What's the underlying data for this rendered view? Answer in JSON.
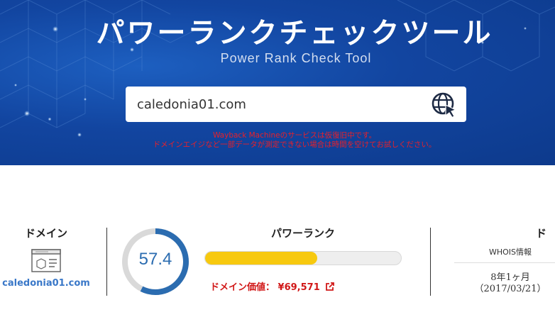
{
  "header": {
    "title": "パワーランクチェックツール",
    "subtitle": "Power Rank Check Tool"
  },
  "search": {
    "value": "caledonia01.com",
    "button_icon": "globe-cursor-icon"
  },
  "notice": {
    "line1": "Wayback Machineのサービスは仮復旧中です。",
    "line2": "ドメインエイジなど一部データが測定できない場合は時間を空けてお試しください。",
    "color": "#e8202a"
  },
  "result": {
    "domain": {
      "label": "ドメイン",
      "icon": "webpage-icon",
      "value": "caledonia01.com"
    },
    "power_rank": {
      "label": "パワーランク",
      "score": "57.4",
      "score_fraction": 0.574,
      "domain_value_label": "ドメイン価値：",
      "domain_value": "¥69,571",
      "link_icon": "external-link-icon"
    },
    "whois": {
      "label": "ド",
      "source": "WHOIS情報",
      "age": "8年1ヶ月",
      "date": "（2017/03/21）"
    }
  },
  "colors": {
    "hero_blue": "#1245a0",
    "gauge_blue": "#2b6cb0",
    "bar_yellow": "#f7c90f",
    "value_red": "#d11818",
    "link_blue": "#3a78c8"
  }
}
